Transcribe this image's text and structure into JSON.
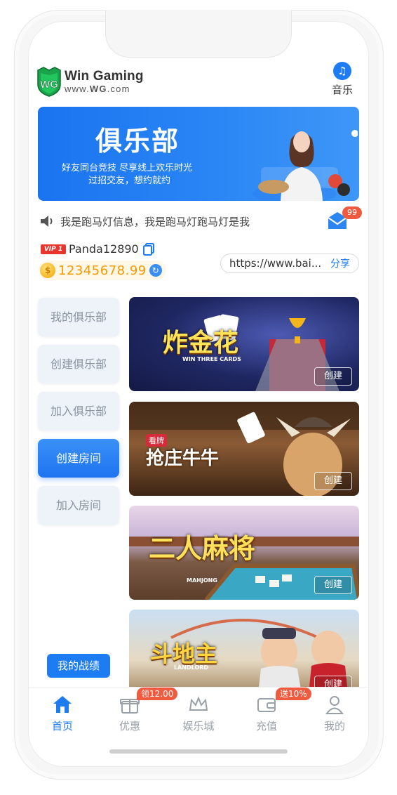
{
  "brand": {
    "name": "Win Gaming",
    "url_prefix": "www.",
    "url_bold": "WG",
    "url_suffix": ".com",
    "logo_text": "WG"
  },
  "music": {
    "label": "音乐"
  },
  "banner": {
    "title": "俱乐部",
    "line1": "好友同台竞技  尽享线上欢乐时光",
    "line2": "过招交友，想约就约"
  },
  "marquee": {
    "text": "我是跑马灯信息，我是跑马灯跑马灯是我"
  },
  "mail": {
    "badge": "99"
  },
  "user": {
    "vip": "VIP 1",
    "name": "Panda12890",
    "balance": "12345678.99"
  },
  "share": {
    "link": "https://www.bai...",
    "label": "分享"
  },
  "side_menu": [
    {
      "label": "我的俱乐部",
      "active": false
    },
    {
      "label": "创建俱乐部",
      "active": false
    },
    {
      "label": "加入俱乐部",
      "active": false
    },
    {
      "label": "创建房间",
      "active": true
    },
    {
      "label": "加入房间",
      "active": false
    }
  ],
  "record_button": "我的战绩",
  "games": [
    {
      "title": "炸金花",
      "subtitle": "WIN THREE CARDS",
      "button": "创建"
    },
    {
      "title": "抢庄牛牛",
      "tag": "看牌",
      "button": "创建"
    },
    {
      "title": "二人麻将",
      "subtitle": "MAHJONG",
      "button": "创建"
    },
    {
      "title": "斗地主",
      "subtitle": "LANDLORD",
      "button": "创建"
    }
  ],
  "tabs": [
    {
      "label": "首页",
      "icon": "home-icon",
      "active": true
    },
    {
      "label": "优惠",
      "icon": "gift-icon",
      "badge": "领12.00"
    },
    {
      "label": "娱乐城",
      "icon": "crown-icon"
    },
    {
      "label": "充值",
      "icon": "wallet-icon",
      "badge": "送10%"
    },
    {
      "label": "我的",
      "icon": "user-icon"
    }
  ],
  "colors": {
    "accent": "#1e7cf2",
    "badge": "#f05a3f",
    "gold": "#f39a00"
  }
}
